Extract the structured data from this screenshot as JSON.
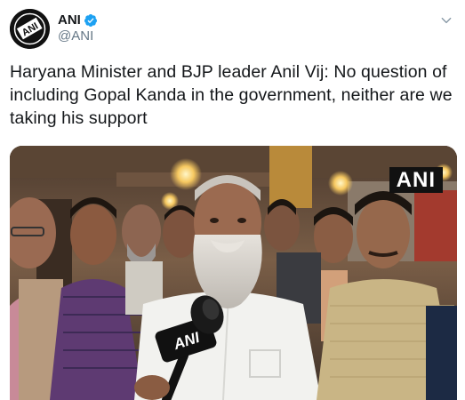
{
  "account": {
    "display_name": "ANI",
    "handle": "@ANI",
    "avatar_text": "ANI",
    "verified": true
  },
  "tweet": {
    "text": "Haryana Minister and BJP leader Anil Vij: No question of including Gopal Kanda in the government, neither are we taking his support"
  },
  "media": {
    "watermark_text": "ANI",
    "mic_label": "ANI"
  },
  "icons": {
    "verified": "verified-badge-icon",
    "menu": "chevron-down-icon"
  },
  "colors": {
    "verified_blue": "#1da1f2",
    "text": "#14171a",
    "secondary_text": "#657786"
  }
}
